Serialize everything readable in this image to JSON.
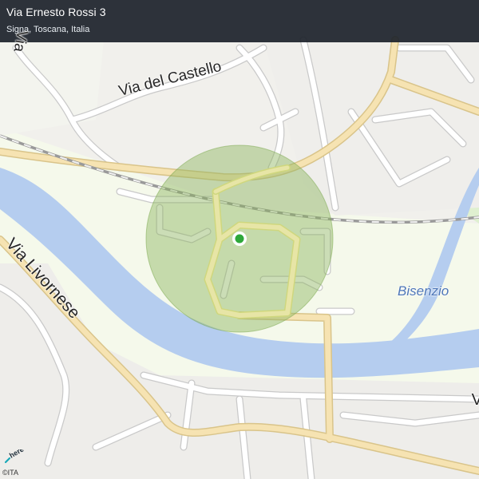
{
  "header": {
    "title": "Via Ernesto Rossi 3",
    "subtitle": "Signa, Toscana, Italia"
  },
  "labels": {
    "via_castello": "Via  del Castello",
    "via_livornese": "Via  Livornese",
    "via_top": "Via",
    "via_edge": "V",
    "river": "Bisenzio"
  },
  "branding": {
    "logo": "here",
    "copyright": "©ITA"
  },
  "colors": {
    "water": "#b5cdef",
    "land_light": "#f5f9eb",
    "urban": "#f1f0ec",
    "major_road": "#f6e3b2",
    "accuracy_circle": "#8bb45e",
    "location_dot": "#2ea83a"
  },
  "icons": {
    "location_marker": "location-dot-icon"
  }
}
